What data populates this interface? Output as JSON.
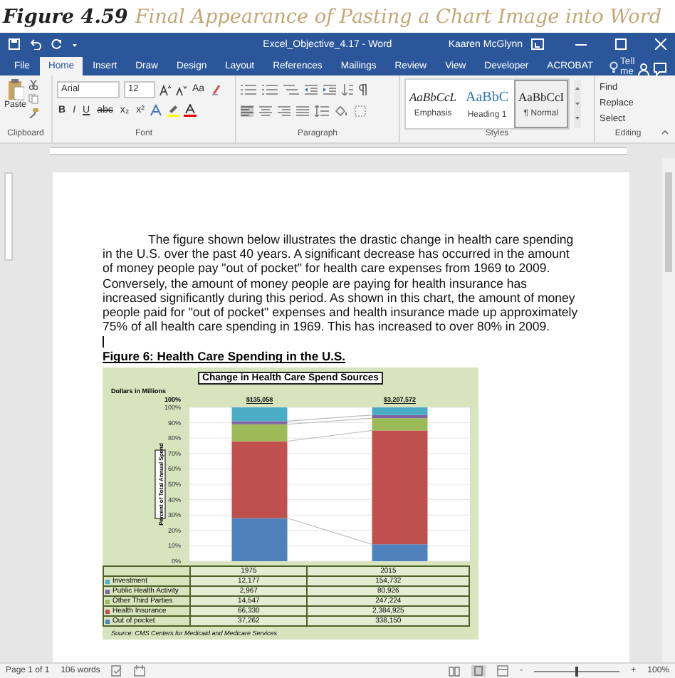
{
  "caption": {
    "label": "Figure 4.59",
    "title": "Final Appearance of Pasting a Chart Image into Word"
  },
  "window": {
    "title": "Excel_Objective_4.17  -  Word",
    "user": "Kaaren McGlynn"
  },
  "tabs": [
    {
      "label": "File",
      "selected": false
    },
    {
      "label": "Home",
      "selected": true
    },
    {
      "label": "Insert",
      "selected": false
    },
    {
      "label": "Draw",
      "selected": false
    },
    {
      "label": "Design",
      "selected": false
    },
    {
      "label": "Layout",
      "selected": false
    },
    {
      "label": "References",
      "selected": false
    },
    {
      "label": "Mailings",
      "selected": false
    },
    {
      "label": "Review",
      "selected": false
    },
    {
      "label": "View",
      "selected": false
    },
    {
      "label": "Developer",
      "selected": false
    },
    {
      "label": "ACROBAT",
      "selected": false
    }
  ],
  "tell_me": {
    "placeholder": "Tell me"
  },
  "ribbon": {
    "clipboard": {
      "paste": "Paste",
      "label": "Clipboard"
    },
    "font": {
      "name": "Arial",
      "size": "12",
      "case": "Aa",
      "buttons": [
        "B",
        "I",
        "U",
        "abc",
        "x₂",
        "x²"
      ],
      "label": "Font"
    },
    "paragraph": {
      "label": "Paragraph"
    },
    "styles": {
      "label": "Styles",
      "items": [
        {
          "sample": "AaBbCcL",
          "name": "Emphasis",
          "kind": "emphasis",
          "selected": false
        },
        {
          "sample": "AaBbC",
          "name": "Heading 1",
          "kind": "heading",
          "selected": false
        },
        {
          "sample": "AaBbCcI",
          "name": "¶ Normal",
          "kind": "normal",
          "selected": true
        }
      ]
    },
    "editing": {
      "label": "Editing",
      "items": [
        "Find",
        "Replace",
        "Select"
      ]
    }
  },
  "document": {
    "paragraph": "The figure shown below illustrates the drastic change in health care spending in the U.S. over the past 40 years.  A significant decrease has occurred in the amount of money people pay \"out of pocket\" for health care expenses from 1969 to 2009.  Conversely, the amount of money people are paying for health insurance has increased significantly during this period.  As shown in this chart, the amount of money people paid for \"out of pocket\" expenses and health insurance made up approximately 75% of all health care spending in 1969.  This has increased to over 80% in 2009.",
    "heading": "Figure 6: Health Care Spending in the U.S.",
    "chart": {
      "title": "Change in Health Care Spend Sources",
      "unit": "Dollars in Millions",
      "top_label": "100%",
      "totals": [
        "$135,058",
        "$3,207,572"
      ],
      "rows": [
        {
          "values": [
            "12,177",
            "154,732"
          ]
        },
        {
          "values": [
            "2,967",
            "80,926"
          ]
        },
        {
          "values": [
            "14,547",
            "247,224"
          ]
        },
        {
          "values": [
            "66,330",
            "2,384,925"
          ]
        },
        {
          "values": [
            "37,262",
            "338,150"
          ]
        }
      ],
      "source": "Source:  CMS Centers for Medicaid and Medicare Services",
      "chart_data": {
        "type": "bar",
        "stacked": true,
        "grid": true,
        "legend": "bottom",
        "ylabel": "Percent of Total Annual Spend",
        "categories": [
          "1975",
          "2015"
        ],
        "ylim": [
          0,
          100
        ],
        "yticks": [
          {
            "value": 0,
            "label": "0%"
          },
          {
            "value": 10,
            "label": "10%"
          },
          {
            "value": 20,
            "label": "20%"
          },
          {
            "value": 30,
            "label": "30%"
          },
          {
            "value": 40,
            "label": "40%"
          },
          {
            "value": 50,
            "label": "50%"
          },
          {
            "value": 60,
            "label": "60%"
          },
          {
            "value": 70,
            "label": "70%"
          },
          {
            "value": 80,
            "label": "80%"
          },
          {
            "value": 90,
            "label": "90%"
          },
          {
            "value": 100,
            "label": "100%"
          }
        ],
        "series": [
          {
            "name": "Out of pocket",
            "color": "#4f81bd",
            "values": [
              28,
              11
            ]
          },
          {
            "name": "Health Insurance",
            "color": "#c0504d",
            "values": [
              50,
              74
            ]
          },
          {
            "name": "Other Third Parties",
            "color": "#9bbb59",
            "values": [
              11,
              8
            ]
          },
          {
            "name": "Public Health Activity",
            "color": "#8064a2",
            "values": [
              2,
              2
            ]
          },
          {
            "name": "Investment",
            "color": "#4bacc6",
            "values": [
              9,
              5
            ]
          }
        ]
      }
    }
  },
  "status_bar": {
    "page": "Page 1 of 1",
    "words": "106 words",
    "zoom": {
      "out": "-",
      "in": "+",
      "level": 0.5,
      "reading": "100%"
    }
  }
}
